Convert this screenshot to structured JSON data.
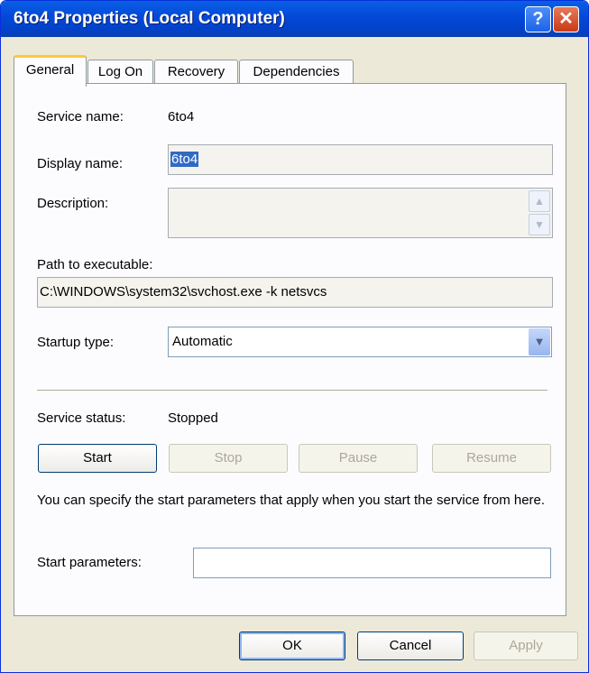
{
  "window": {
    "title": "6to4 Properties (Local Computer)",
    "help_glyph": "?",
    "close_glyph": "✕"
  },
  "tabs": [
    {
      "label": "General",
      "active": true
    },
    {
      "label": "Log On",
      "active": false
    },
    {
      "label": "Recovery",
      "active": false
    },
    {
      "label": "Dependencies",
      "active": false
    }
  ],
  "general": {
    "service_name_label": "Service name:",
    "service_name_value": "6to4",
    "display_name_label": "Display name:",
    "display_name_value": "6to4",
    "description_label": "Description:",
    "description_value": "",
    "path_label": "Path to executable:",
    "path_value": "C:\\WINDOWS\\system32\\svchost.exe -k netsvcs",
    "startup_type_label": "Startup type:",
    "startup_type_value": "Automatic",
    "service_status_label": "Service status:",
    "service_status_value": "Stopped",
    "buttons": {
      "start": "Start",
      "stop": "Stop",
      "pause": "Pause",
      "resume": "Resume"
    },
    "help_text": "You can specify the start parameters that apply when you start the service from here.",
    "start_params_label": "Start parameters:",
    "start_params_value": ""
  },
  "footer": {
    "ok": "OK",
    "cancel": "Cancel",
    "apply": "Apply"
  },
  "colors": {
    "titlebar": "#0348d8",
    "selection": "#316ac5",
    "tab_highlight": "#ffc83c",
    "dialog_bg": "#ece9d8"
  }
}
